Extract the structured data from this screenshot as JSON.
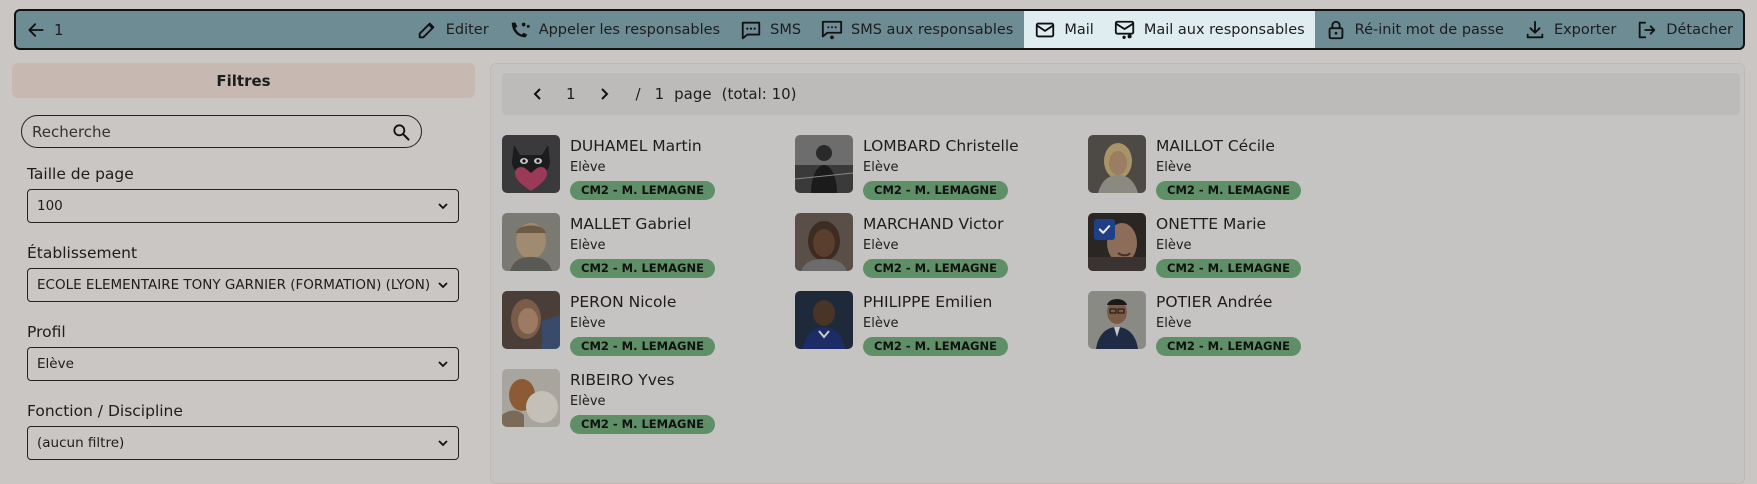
{
  "toolbar": {
    "selection_count": "1",
    "buttons": [
      {
        "label": "Editer"
      },
      {
        "label": "Appeler les responsables"
      },
      {
        "label": "SMS"
      },
      {
        "label": "SMS aux responsables"
      },
      {
        "label": "Mail"
      },
      {
        "label": "Mail aux responsables"
      },
      {
        "label": "Ré-init mot de passe"
      },
      {
        "label": "Exporter"
      },
      {
        "label": "Détacher"
      }
    ]
  },
  "filters": {
    "title": "Filtres",
    "search_placeholder": "Recherche",
    "page_size": {
      "label": "Taille de page",
      "value": "100"
    },
    "etablissement": {
      "label": "Établissement",
      "value": "ECOLE ELEMENTAIRE TONY GARNIER (FORMATION) (LYON)"
    },
    "profil": {
      "label": "Profil",
      "value": "Elève"
    },
    "fonction": {
      "label": "Fonction / Discipline",
      "value": "(aucun filtre)"
    }
  },
  "pager": {
    "current": "1",
    "separator": "/",
    "total_pages": "1",
    "page_word": "page",
    "total_text": "(total: 10)"
  },
  "users": [
    {
      "name": "DUHAMEL Martin",
      "role": "Elève",
      "class": "CM2 - M. LEMAGNE",
      "avatar": "cat-heart-avatar"
    },
    {
      "name": "LOMBARD Christelle",
      "role": "Elève",
      "class": "CM2 - M. LEMAGNE",
      "avatar": "photo-avatar"
    },
    {
      "name": "MAILLOT Cécile",
      "role": "Elève",
      "class": "CM2 - M. LEMAGNE",
      "avatar": "photo-avatar"
    },
    {
      "name": "MALLET Gabriel",
      "role": "Elève",
      "class": "CM2 - M. LEMAGNE",
      "avatar": "photo-avatar"
    },
    {
      "name": "MARCHAND Victor",
      "role": "Elève",
      "class": "CM2 - M. LEMAGNE",
      "avatar": "photo-avatar"
    },
    {
      "name": "ONETTE Marie",
      "role": "Elève",
      "class": "CM2 - M. LEMAGNE",
      "avatar": "photo-avatar",
      "selected": true
    },
    {
      "name": "PERON Nicole",
      "role": "Elève",
      "class": "CM2 - M. LEMAGNE",
      "avatar": "photo-avatar"
    },
    {
      "name": "PHILIPPE Emilien",
      "role": "Elève",
      "class": "CM2 - M. LEMAGNE",
      "avatar": "photo-avatar"
    },
    {
      "name": "POTIER Andrée",
      "role": "Elève",
      "class": "CM2 - M. LEMAGNE",
      "avatar": "photo-avatar"
    },
    {
      "name": "RIBEIRO Yves",
      "role": "Elève",
      "class": "CM2 - M. LEMAGNE",
      "avatar": "photo-avatar"
    }
  ],
  "colors": {
    "toolbar_bg": "#6e8c94",
    "highlight_bg": "#dfecf0",
    "badge_bg": "#5f8f67",
    "checkbox": "#1f3f88"
  }
}
